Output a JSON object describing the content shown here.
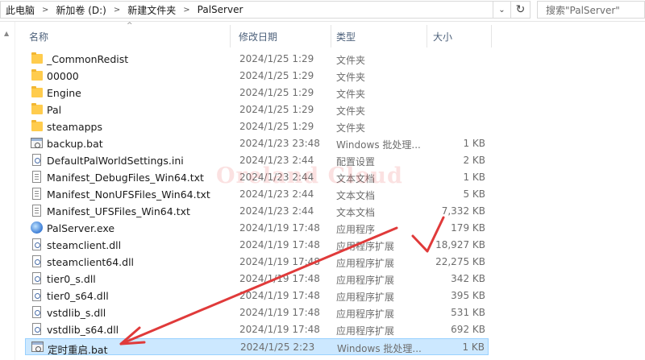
{
  "address": {
    "crumbs": [
      "此电脑",
      "新加卷 (D:)",
      "新建文件夹",
      "PalServer"
    ],
    "dropdown_glyph": "⌄",
    "refresh_glyph": "↻"
  },
  "search": {
    "placeholder": "搜索\"PalServer\""
  },
  "columns": {
    "name": "名称",
    "date": "修改日期",
    "type": "类型",
    "size": "大小"
  },
  "files": [
    {
      "name": "_CommonRedist",
      "date": "2024/1/25 1:29",
      "type": "文件夹",
      "size": "",
      "icon": "folder-icon"
    },
    {
      "name": "00000",
      "date": "2024/1/25 1:29",
      "type": "文件夹",
      "size": "",
      "icon": "folder-icon"
    },
    {
      "name": "Engine",
      "date": "2024/1/25 1:29",
      "type": "文件夹",
      "size": "",
      "icon": "folder-icon"
    },
    {
      "name": "Pal",
      "date": "2024/1/25 1:29",
      "type": "文件夹",
      "size": "",
      "icon": "folder-icon"
    },
    {
      "name": "steamapps",
      "date": "2024/1/25 1:29",
      "type": "文件夹",
      "size": "",
      "icon": "folder-icon"
    },
    {
      "name": "backup.bat",
      "date": "2024/1/23 23:48",
      "type": "Windows 批处理...",
      "size": "1 KB",
      "icon": "batch-file-icon"
    },
    {
      "name": "DefaultPalWorldSettings.ini",
      "date": "2024/1/23 2:44",
      "type": "配置设置",
      "size": "2 KB",
      "icon": "settings-file-icon"
    },
    {
      "name": "Manifest_DebugFiles_Win64.txt",
      "date": "2024/1/23 2:44",
      "type": "文本文档",
      "size": "1 KB",
      "icon": "text-file-icon"
    },
    {
      "name": "Manifest_NonUFSFiles_Win64.txt",
      "date": "2024/1/23 2:44",
      "type": "文本文档",
      "size": "5 KB",
      "icon": "text-file-icon"
    },
    {
      "name": "Manifest_UFSFiles_Win64.txt",
      "date": "2024/1/23 2:44",
      "type": "文本文档",
      "size": "7,332 KB",
      "icon": "text-file-icon"
    },
    {
      "name": "PalServer.exe",
      "date": "2024/1/19 17:48",
      "type": "应用程序",
      "size": "179 KB",
      "icon": "exe-icon"
    },
    {
      "name": "steamclient.dll",
      "date": "2024/1/19 17:48",
      "type": "应用程序扩展",
      "size": "18,927 KB",
      "icon": "dll-file-icon"
    },
    {
      "name": "steamclient64.dll",
      "date": "2024/1/19 17:48",
      "type": "应用程序扩展",
      "size": "22,275 KB",
      "icon": "dll-file-icon"
    },
    {
      "name": "tier0_s.dll",
      "date": "2024/1/19 17:48",
      "type": "应用程序扩展",
      "size": "342 KB",
      "icon": "dll-file-icon"
    },
    {
      "name": "tier0_s64.dll",
      "date": "2024/1/19 17:48",
      "type": "应用程序扩展",
      "size": "395 KB",
      "icon": "dll-file-icon"
    },
    {
      "name": "vstdlib_s.dll",
      "date": "2024/1/19 17:48",
      "type": "应用程序扩展",
      "size": "531 KB",
      "icon": "dll-file-icon"
    },
    {
      "name": "vstdlib_s64.dll",
      "date": "2024/1/19 17:48",
      "type": "应用程序扩展",
      "size": "692 KB",
      "icon": "dll-file-icon"
    },
    {
      "name": "定时重启.bat",
      "date": "2024/1/25 2:23",
      "type": "Windows 批处理...",
      "size": "1 KB",
      "icon": "batch-file-icon",
      "selected": true
    }
  ],
  "watermark": "Oreland Cloud",
  "colors": {
    "selection": "#cce8ff",
    "annotation": "#e03a3a",
    "folder": "#ffcc4d"
  }
}
